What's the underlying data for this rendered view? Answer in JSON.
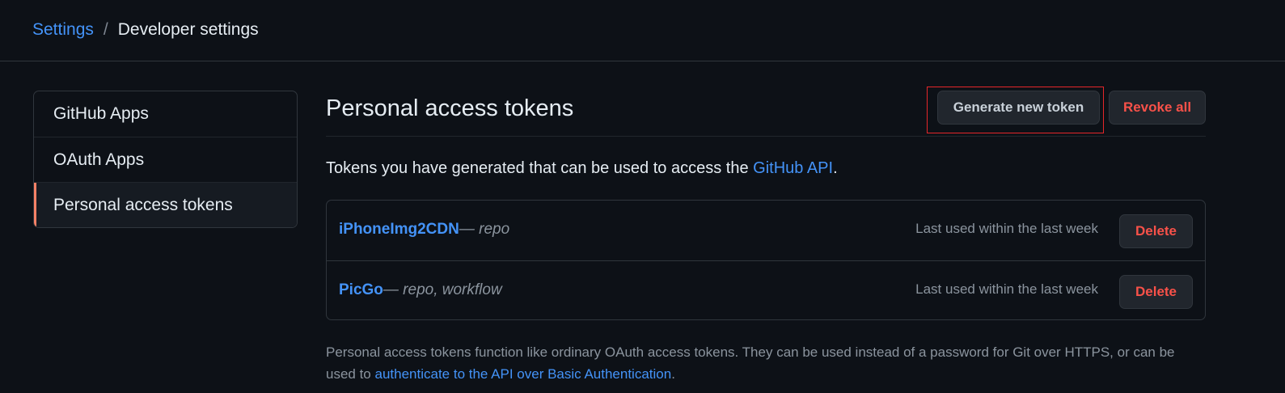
{
  "breadcrumb": {
    "parent": "Settings",
    "separator": "/",
    "current": "Developer settings"
  },
  "sidebar": {
    "items": [
      {
        "label": "GitHub Apps",
        "selected": false
      },
      {
        "label": "OAuth Apps",
        "selected": false
      },
      {
        "label": "Personal access tokens",
        "selected": true
      }
    ]
  },
  "main": {
    "title": "Personal access tokens",
    "generate_label": "Generate new token",
    "revoke_label": "Revoke all",
    "intro_text": "Tokens you have generated that can be used to access the ",
    "intro_link": "GitHub API",
    "intro_end": "."
  },
  "tokens": [
    {
      "name": "iPhoneImg2CDN",
      "scopes": " — repo",
      "last_used": "Last used within the last week",
      "delete_label": "Delete"
    },
    {
      "name": "PicGo",
      "scopes": " — repo, workflow",
      "last_used": "Last used within the last week",
      "delete_label": "Delete"
    }
  ],
  "footer": {
    "text": "Personal access tokens function like ordinary OAuth access tokens. They can be used instead of a password for Git over HTTPS, or can be used to ",
    "link": "authenticate to the API over Basic Authentication",
    "end": "."
  },
  "colors": {
    "background": "#0d1117",
    "link": "#4493f8",
    "danger": "#f85149",
    "selected_indicator": "#f78166",
    "highlight_box": "#e5262a"
  }
}
